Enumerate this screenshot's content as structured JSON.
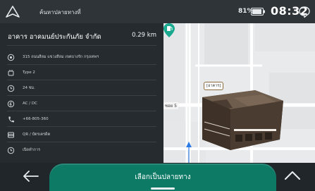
{
  "status_bar": {
    "search_placeholder": "ค้นหาปลายทางที่",
    "battery_percent": "81%",
    "time": "08:32",
    "icons": [
      "navigation-arrow-icon",
      "battery-icon",
      "chat-icon"
    ]
  },
  "poi": {
    "name": "อาคาร อาคมนย์ประกันภัย จำกัด",
    "distance": "0.29 km",
    "details": [
      {
        "icon": "location-icon",
        "text": "315 ถนนสีลม แขวงสีลม เขตบางรัก กรุงเทพฯ"
      },
      {
        "icon": "plug-icon",
        "text": "Type 2"
      },
      {
        "icon": "clock-icon",
        "text": "24 ชม."
      },
      {
        "icon": "charger-icon",
        "text": "AC / DC"
      },
      {
        "icon": "phone-icon",
        "text": "+66-805-360"
      },
      {
        "icon": "card-icon",
        "text": "QR / บัตรเครดิต"
      },
      {
        "icon": "info-icon",
        "text": "เปิดทำการ"
      }
    ]
  },
  "map": {
    "building_label": "[อาคาร]",
    "road_label": "ซอย 5"
  },
  "bottom": {
    "cta_label": "เลือกเป็นปลายทาง"
  },
  "colors": {
    "accent": "#0d7a66",
    "panel": "#252b2e",
    "status_bar": "#2e3438"
  }
}
